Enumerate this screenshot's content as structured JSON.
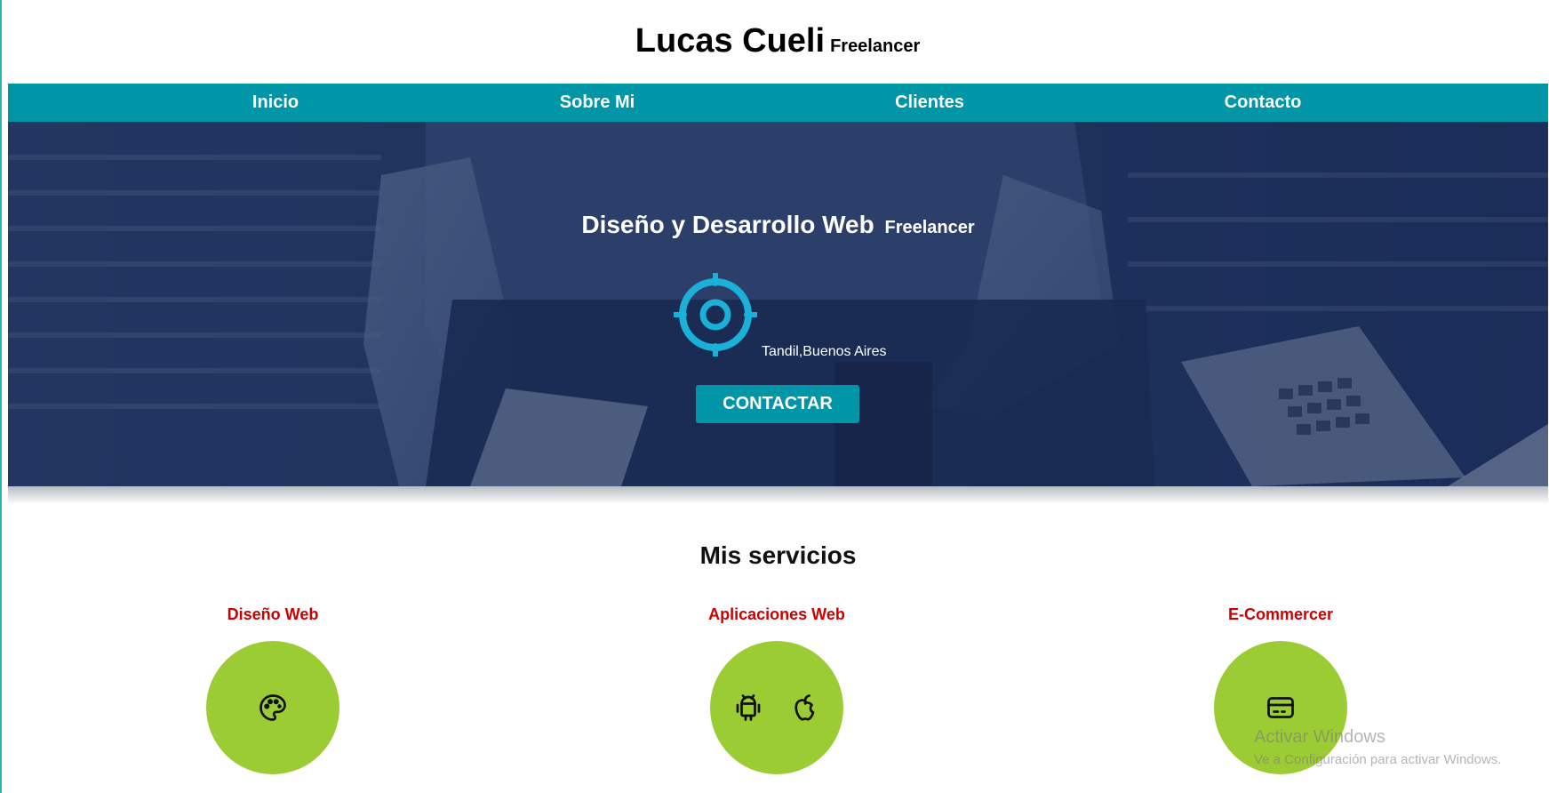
{
  "header": {
    "name": "Lucas Cueli",
    "subtitle": "Freelancer"
  },
  "nav": {
    "items": [
      {
        "label": "Inicio"
      },
      {
        "label": "Sobre Mi"
      },
      {
        "label": "Clientes"
      },
      {
        "label": "Contacto"
      }
    ]
  },
  "hero": {
    "title": "Diseño y Desarrollo Web",
    "subtitle": "Freelancer",
    "location_icon": "target-icon",
    "location": "Tandil,Buenos Aires",
    "cta_label": "CONTACTAR"
  },
  "services": {
    "title": "Mis servicios",
    "items": [
      {
        "name": "Diseño Web",
        "icons": [
          "palette-icon"
        ]
      },
      {
        "name": "Aplicaciones Web",
        "icons": [
          "android-icon",
          "apple-icon"
        ]
      },
      {
        "name": "E-Commercer",
        "icons": [
          "credit-card-icon"
        ]
      }
    ]
  },
  "watermark": {
    "title": "Activar Windows",
    "subtitle": "Ve a Configuración para activar Windows."
  },
  "colors": {
    "nav_bg": "#0096a7",
    "hero_overlay": "#22365f",
    "service_circle": "#9ccc34",
    "service_name": "#cc0000",
    "target_icon": "#1ab0d8"
  }
}
